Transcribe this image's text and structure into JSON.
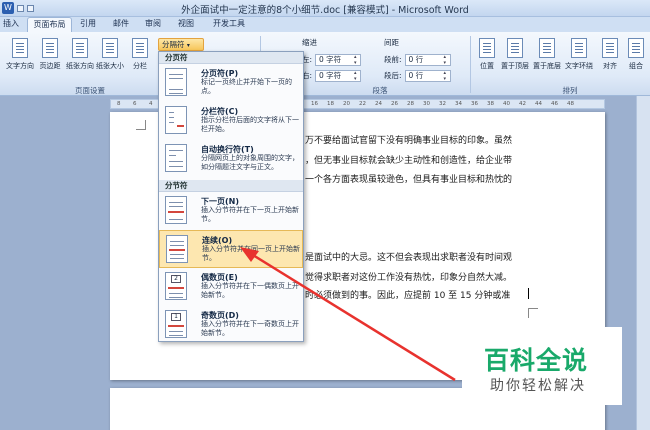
{
  "title_bar": {
    "title": "外企面试中一定注意的8个小细节.doc [兼容模式] - Microsoft Word"
  },
  "tabs": [
    {
      "label": "插入"
    },
    {
      "label": "页面布局",
      "active": true
    },
    {
      "label": "引用"
    },
    {
      "label": "邮件"
    },
    {
      "label": "审阅"
    },
    {
      "label": "视图"
    },
    {
      "label": "开发工具"
    }
  ],
  "ribbon": {
    "page_setup": {
      "buttons": [
        "文字方向",
        "页边距",
        "纸张方向",
        "纸张大小",
        "分栏"
      ],
      "label": "页面设置",
      "breaks_button": "分隔符"
    },
    "paragraph": {
      "indent_label": "缩进",
      "spacing_label": "间距",
      "left_label": "左:",
      "right_label": "右:",
      "before_label": "段前:",
      "after_label": "段后:",
      "indent_left_value": "0 字符",
      "indent_right_value": "0 字符",
      "spacing_before_value": "0 行",
      "spacing_after_value": "0 行",
      "label": "段落"
    },
    "arrange": {
      "buttons": [
        "位置",
        "置于顶层",
        "置于底层",
        "文字环绕",
        "对齐",
        "组合"
      ],
      "label": "排列"
    }
  },
  "ruler_ticks": [
    "8",
    "6",
    "4",
    "2",
    "16",
    "18",
    "20",
    "22",
    "24",
    "26",
    "28",
    "30",
    "32",
    "34",
    "36",
    "38",
    "40",
    "42",
    "44",
    "46",
    "48"
  ],
  "breaks_menu": {
    "section_page": "分页符",
    "section_section": "分节符",
    "items": [
      {
        "title": "分页符(P)",
        "desc": "标记一页终止并开始下一页的点。"
      },
      {
        "title": "分栏符(C)",
        "desc": "指示分栏符后面的文字将从下一栏开始。"
      },
      {
        "title": "自动换行符(T)",
        "desc": "分隔网页上的对象周围的文字，如分隔题注文字与正文。"
      },
      {
        "title": "下一页(N)",
        "desc": "插入分节符并在下一页上开始新节。"
      },
      {
        "title": "连续(O)",
        "desc": "插入分节符并在同一页上开始新节。"
      },
      {
        "title": "偶数页(E)",
        "desc": "插入分节符并在下一偶数页上开始新节。"
      },
      {
        "title": "奇数页(D)",
        "desc": "插入分节符并在下一奇数页上开始新节。"
      }
    ],
    "even_num": "2",
    "odd_num": "1"
  },
  "document": {
    "lines": [
      "万不要给面试官留下没有明确事业目标的印象。虽然",
      "，但无事业目标就会缺少主动性和创造性，给企业带",
      "一个各方面表现虽较逊色，但具有事业目标和热忱的",
      "是面试中的大忌。这不但会表现出求职者没有时间观",
      "觉得求职者对这份工作没有热忱，印象分自然大减。",
      "时必须做到的事。因此，应提前 10 至 15 分钟或准"
    ]
  },
  "watermark": {
    "title": "百科全说",
    "subtitle": "助你轻松解决"
  },
  "colors": {
    "highlight": "#fde7b0",
    "arrow": "#e8322e",
    "watermark_green": "#19a96a"
  }
}
